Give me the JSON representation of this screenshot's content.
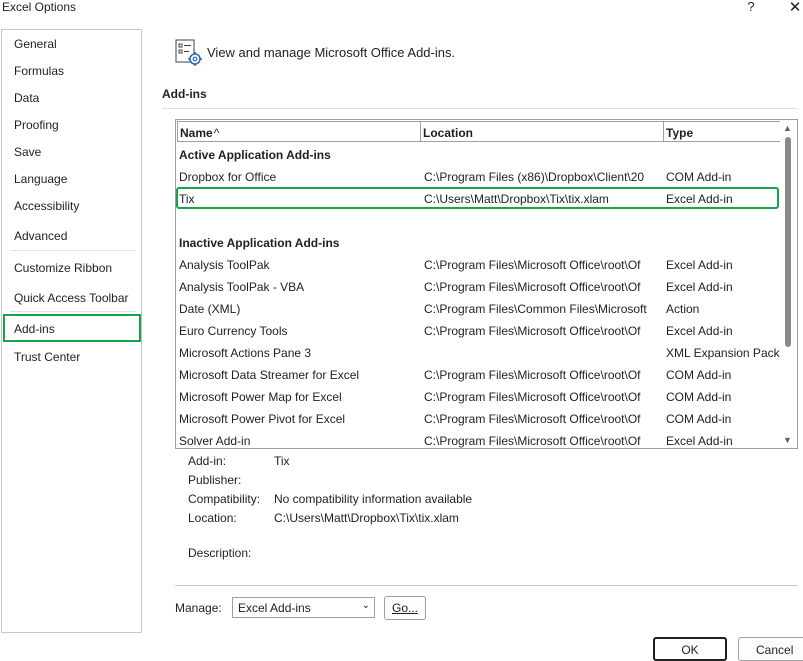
{
  "window": {
    "title": "Excel Options",
    "help": "?",
    "close": "✕"
  },
  "sidebar": {
    "items": [
      "General",
      "Formulas",
      "Data",
      "Proofing",
      "Save",
      "Language",
      "Accessibility",
      "Advanced",
      "Customize Ribbon",
      "Quick Access Toolbar",
      "Add-ins",
      "Trust Center"
    ],
    "selected": "Add-ins"
  },
  "header": {
    "icon": "addins-gear-icon",
    "text": "View and manage Microsoft Office Add-ins."
  },
  "section": {
    "title": "Add-ins"
  },
  "table": {
    "columns": {
      "name": "Name",
      "sort": "^",
      "location": "Location",
      "type": "Type"
    },
    "active_group": "Active Application Add-ins",
    "active": [
      {
        "name": "Dropbox for Office",
        "location": "C:\\Program Files (x86)\\Dropbox\\Client\\20",
        "type": "COM Add-in"
      },
      {
        "name": "Tix",
        "location": "C:\\Users\\Matt\\Dropbox\\Tix\\tix.xlam",
        "type": "Excel Add-in"
      }
    ],
    "inactive_group": "Inactive Application Add-ins",
    "inactive": [
      {
        "name": "Analysis ToolPak",
        "location": "C:\\Program Files\\Microsoft Office\\root\\Of",
        "type": "Excel Add-in"
      },
      {
        "name": "Analysis ToolPak - VBA",
        "location": "C:\\Program Files\\Microsoft Office\\root\\Of",
        "type": "Excel Add-in"
      },
      {
        "name": "Date (XML)",
        "location": "C:\\Program Files\\Common Files\\Microsoft",
        "type": "Action"
      },
      {
        "name": "Euro Currency Tools",
        "location": "C:\\Program Files\\Microsoft Office\\root\\Of",
        "type": "Excel Add-in"
      },
      {
        "name": "Microsoft Actions Pane 3",
        "location": "",
        "type": "XML Expansion Pack"
      },
      {
        "name": "Microsoft Data Streamer for Excel",
        "location": "C:\\Program Files\\Microsoft Office\\root\\Of",
        "type": "COM Add-in"
      },
      {
        "name": "Microsoft Power Map for Excel",
        "location": "C:\\Program Files\\Microsoft Office\\root\\Of",
        "type": "COM Add-in"
      },
      {
        "name": "Microsoft Power Pivot for Excel",
        "location": "C:\\Program Files\\Microsoft Office\\root\\Of",
        "type": "COM Add-in"
      },
      {
        "name": "Solver Add-in",
        "location": "C:\\Program Files\\Microsoft Office\\root\\Of",
        "type": "Excel Add-in"
      }
    ],
    "selected_row": "Tix",
    "highlight_color": "#16a34a"
  },
  "details": {
    "addin_label": "Add-in:",
    "addin_value": "Tix",
    "publisher_label": "Publisher:",
    "publisher_value": "",
    "compat_label": "Compatibility:",
    "compat_value": "No compatibility information available",
    "location_label": "Location:",
    "location_value": "C:\\Users\\Matt\\Dropbox\\Tix\\tix.xlam",
    "description_label": "Description:",
    "description_value": ""
  },
  "manage": {
    "label": "Manage:",
    "selected": "Excel Add-ins",
    "go_label": "Go..."
  },
  "footer": {
    "ok_label": "OK",
    "cancel_label": "Cancel"
  }
}
